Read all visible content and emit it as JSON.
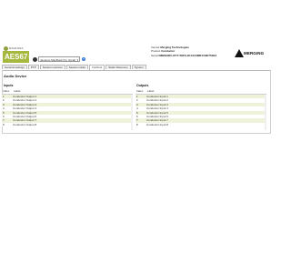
{
  "logo": {
    "product_top": "RAVENNA",
    "word": "AES67",
    "sub": "tool"
  },
  "device": {
    "selected": "Janeiros MacBook Pro (local)"
  },
  "meta": {
    "vendor_label": "Vendor",
    "vendor": "Merging Technologies",
    "product_label": "Product",
    "product": "Conductor",
    "serial_label": "Serial",
    "serial": "D8B09305-3777-5DF9-9CC9-D88FC30E75D13"
  },
  "brand": {
    "name": "MERGING"
  },
  "tabs": [
    "General settings",
    "PTP",
    "Session sources",
    "Session sinks",
    "Ins/Outs",
    "Static Discovery",
    "System"
  ],
  "active_tab": "Ins/Outs",
  "page": {
    "title": "Audio Device"
  },
  "inputs": {
    "heading": "Inputs",
    "col_index": "Index",
    "col_label": "Label",
    "rows": [
      {
        "index": "1",
        "label": "Conductor Output 1"
      },
      {
        "index": "2",
        "label": "Conductor Output 2"
      },
      {
        "index": "3",
        "label": "Conductor Output 3"
      },
      {
        "index": "4",
        "label": "Conductor Output 4"
      },
      {
        "index": "5",
        "label": "Conductor Output 5"
      },
      {
        "index": "6",
        "label": "Conductor Output 6"
      },
      {
        "index": "7",
        "label": "Conductor Output 7"
      },
      {
        "index": "8",
        "label": "Conductor Output 8"
      }
    ]
  },
  "outputs": {
    "heading": "Outputs",
    "col_index": "Index",
    "col_label": "Label",
    "rows": [
      {
        "index": "1",
        "label": "Conductor Input 1"
      },
      {
        "index": "2",
        "label": "Conductor Input 2"
      },
      {
        "index": "3",
        "label": "Conductor Input 3"
      },
      {
        "index": "4",
        "label": "Conductor Input 4"
      },
      {
        "index": "5",
        "label": "Conductor Input 5"
      },
      {
        "index": "6",
        "label": "Conductor Input 6"
      },
      {
        "index": "7",
        "label": "Conductor Input 7"
      },
      {
        "index": "8",
        "label": "Conductor Input 8"
      }
    ]
  }
}
